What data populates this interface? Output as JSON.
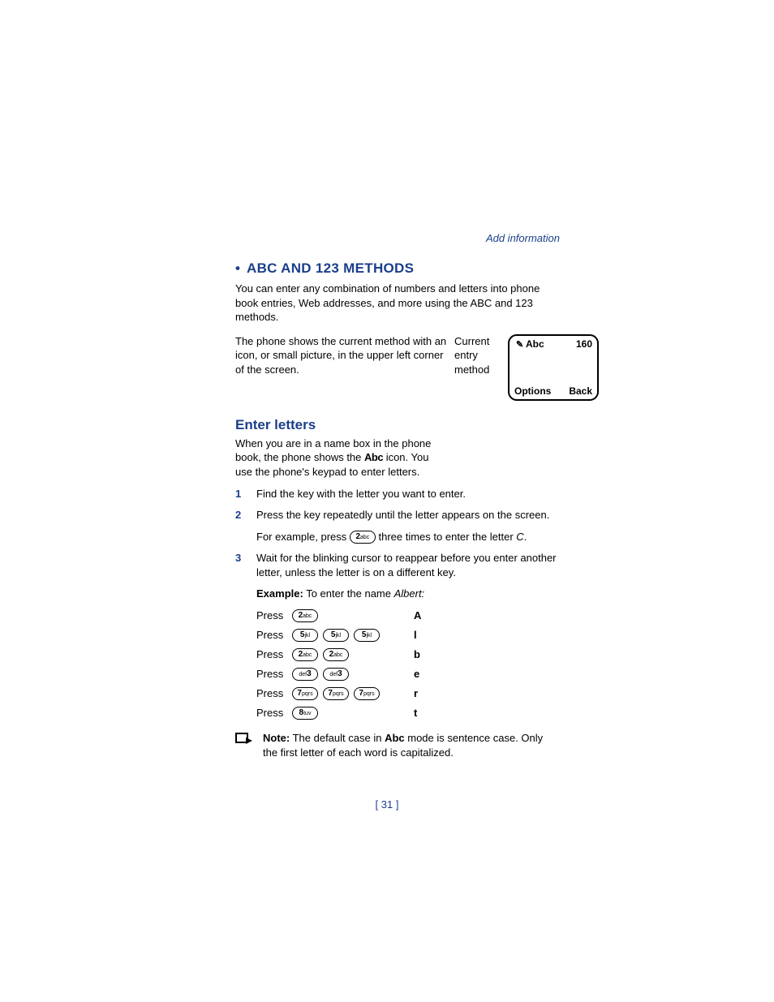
{
  "header_link": "Add information",
  "h1": "ABC AND 123 METHODS",
  "intro": "You can enter any combination of numbers and letters into phone book entries, Web addresses, and more using the ABC and 123 methods.",
  "icon_para": "The phone shows the current method with an icon, or small picture, in the upper left corner of the screen.",
  "callout": "Current entry method",
  "phone": {
    "mode": "Abc",
    "count": "160",
    "left": "Options",
    "right": "Back"
  },
  "h2": "Enter letters",
  "enter_para_a": "When you are in a name box in the phone book, the phone shows the ",
  "enter_abc_icon": "Abc",
  "enter_para_b": " icon. You use the phone's keypad to enter letters.",
  "steps": {
    "s1": "Find the key with the letter you want to enter.",
    "s2": "Press the key repeatedly until the letter appears on the screen.",
    "s2_sub_a": "For example, press ",
    "s2_sub_b": " three times to enter the letter ",
    "s2_letter": "C",
    "s3": "Wait for the blinking cursor to reappear before you enter another letter, unless the letter is on a different key.",
    "example_label": "Example:",
    "example_text": " To enter the name ",
    "example_name": "Albert:"
  },
  "keys": {
    "k2n": "2",
    "k2s": "abc",
    "k3n": "3",
    "k3s": "def",
    "k5n": "5",
    "k5s": "jkl",
    "k7n": "7",
    "k7s": "pqrs",
    "k8n": "8",
    "k8s": "tuv"
  },
  "press_label": "Press",
  "ex_rows_letters": {
    "r1": "A",
    "r2": "l",
    "r3": "b",
    "r4": "e",
    "r5": "r",
    "r6": "t"
  },
  "note": {
    "label": "Note:",
    "text_a": "  The default case in ",
    "abc": "Abc",
    "text_b": " mode is sentence case. Only the first letter of each word is capitalized."
  },
  "page_number": "[ 31 ]"
}
